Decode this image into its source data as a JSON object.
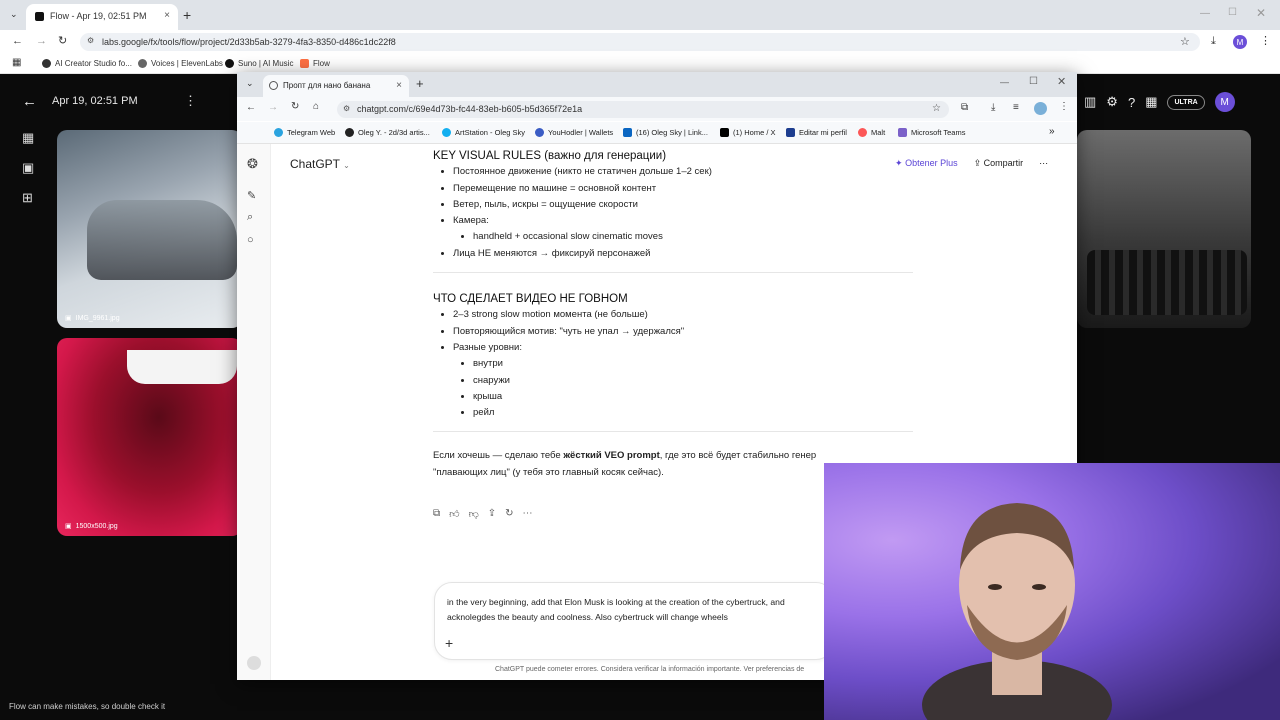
{
  "back_window": {
    "tab_title": "Flow - Apr 19, 02:51 PM",
    "url": "labs.google/fx/tools/flow/project/2d33b5ab-3279-4fa3-8350-d486c1dc22f8",
    "account_initial": "M",
    "bookmarks": [
      "AI Creator Studio fo...",
      "Voices | ElevenLabs",
      "Suno | AI Music",
      "Flow"
    ]
  },
  "flow": {
    "date_title": "Apr 19, 02:51 PM",
    "tile1_label": "IMG_9961.jpg",
    "tile2_label": "1500x500.jpg",
    "plan_badge": "ULTRA",
    "avatar_initial": "M",
    "footer_note": "Flow can make mistakes, so double check it"
  },
  "front_window": {
    "tab_title": "Пропт для нано банана",
    "url": "chatgpt.com/c/69e4d73b-fc44-83eb-b605-b5d365f72e1a",
    "bookmarks": [
      "Telegram Web",
      "Oleg Y. - 2d/3d artis...",
      "ArtStation - Oleg Sky",
      "YouHodler | Wallets",
      "(16) Oleg Sky | Link...",
      "(1) Home / X",
      "Editar mi perfil",
      "Malt",
      "Microsoft Teams"
    ]
  },
  "chatgpt": {
    "title": "ChatGPT",
    "upgrade": "Obtener Plus",
    "share": "Compartir",
    "section1_heading": "KEY VISUAL RULES (важно для генерации)",
    "s1": [
      "Постоянное движение (никто не статичен дольше 1–2 сек)",
      "Перемещение по машине = основной контент",
      "Ветер, пыль, искры = ощущение скорости",
      "Камера:",
      "handheld + occasional slow cinematic moves",
      "Лица НЕ меняются → фиксируй персонажей"
    ],
    "section2_heading": "ЧТО СДЕЛАЕТ ВИДЕО НЕ ГОВНОМ",
    "s2": [
      "2–3 strong slow motion момента (не больше)",
      "Повторяющийся мотив: \"чуть не упал → удержался\"",
      "Разные уровни:",
      "внутри",
      "снаружи",
      "крыша",
      "рейл"
    ],
    "closing_prefix": "Если хочешь — сделаю тебе ",
    "closing_bold": "жёсткий VEO prompt",
    "closing_suffix": ", где это всё будет стабильно генер",
    "closing_line2": "\"плавающих лиц\" (у тебя это главный косяк сейчас).",
    "composer_text": "in the very beginning, add that Elon Musk is looking at the creation of the cybertruck, and acknolegdes the beauty and coolness. Also cybertruck will change wheels",
    "disclaimer": "ChatGPT puede cometer errores. Considera verificar la información importante. Ver preferencias de"
  }
}
